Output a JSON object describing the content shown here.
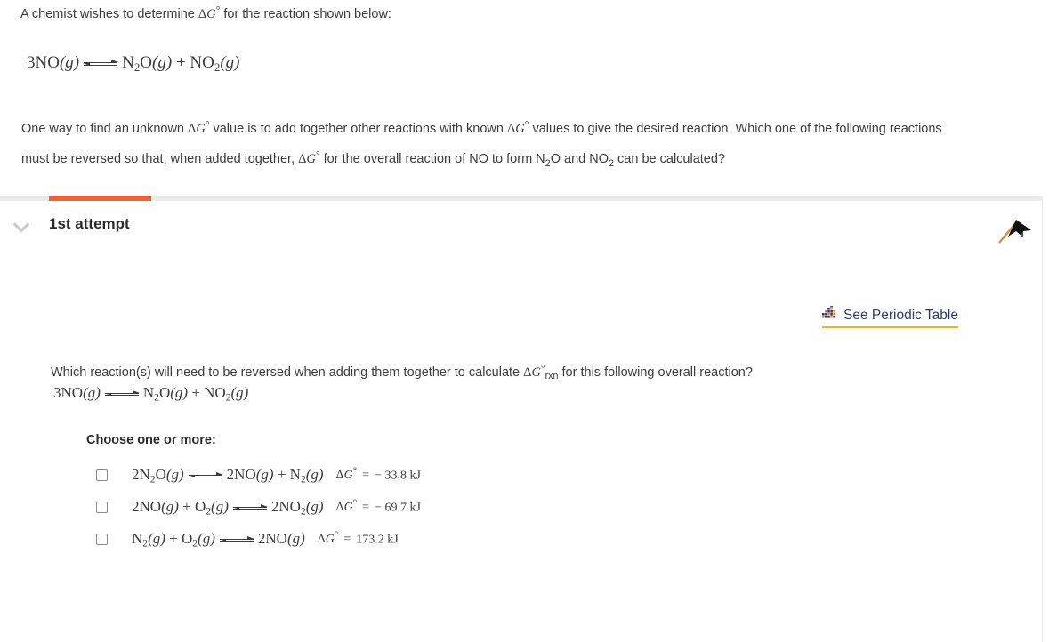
{
  "prompt": {
    "intro": "A chemist wishes to determine ΔG° for the reaction shown below:",
    "equation": {
      "left": "3NO(g)",
      "arrow": "equilibrium-arrow",
      "right": "N2O(g) + NO2(g)",
      "plain": "3NO(g) ⇌ N2O(g) + NO2(g)"
    },
    "paragraph": "One way to find an unknown ΔG° value is to add together other reactions with known ΔG° values to give the desired reaction. Which one of the following reactions must be reversed so that, when added together, ΔG° for the overall reaction of NO to form N2O and NO2 can be calculated?"
  },
  "attempt": {
    "title": "1st attempt",
    "progress_percent": 10,
    "progress_color": "#ec6339",
    "track_color": "#ebebeb",
    "chevron_icon": "chevron-down-icon",
    "flag_icon": "flag-icon"
  },
  "periodic_table_link": {
    "label": "See Periodic Table",
    "icon": "periodic-table-icon",
    "text_color": "#2b3c6b",
    "underline_color": "#e8b33a"
  },
  "question": {
    "text_before_dg": "Which reaction(s) will need to be reversed when adding them together to calculate ",
    "dg_symbol": "ΔG°",
    "dg_subscript": "rxn",
    "text_after_dg": " for this following overall reaction?",
    "equation_plain": "3NO(g) ⇌ N2O(g) + NO2(g)",
    "choose_label": "Choose one or more:"
  },
  "options": [
    {
      "id": "option-1",
      "checked": false,
      "equation_plain": "2N2O(g) ⇌ 2NO(g) + N2(g)",
      "dg_label": "ΔG°",
      "dg_equals": "=",
      "dg_value": "− 33.8 kJ"
    },
    {
      "id": "option-2",
      "checked": false,
      "equation_plain": "2NO(g) + O2(g) ⇌ 2NO2(g)",
      "dg_label": "ΔG°",
      "dg_equals": "=",
      "dg_value": "− 69.7 kJ"
    },
    {
      "id": "option-3",
      "checked": false,
      "equation_plain": "N2(g) + O2(g) ⇌ 2NO(g)",
      "dg_label": "ΔG°",
      "dg_equals": "=",
      "dg_value": "173.2 kJ"
    }
  ]
}
